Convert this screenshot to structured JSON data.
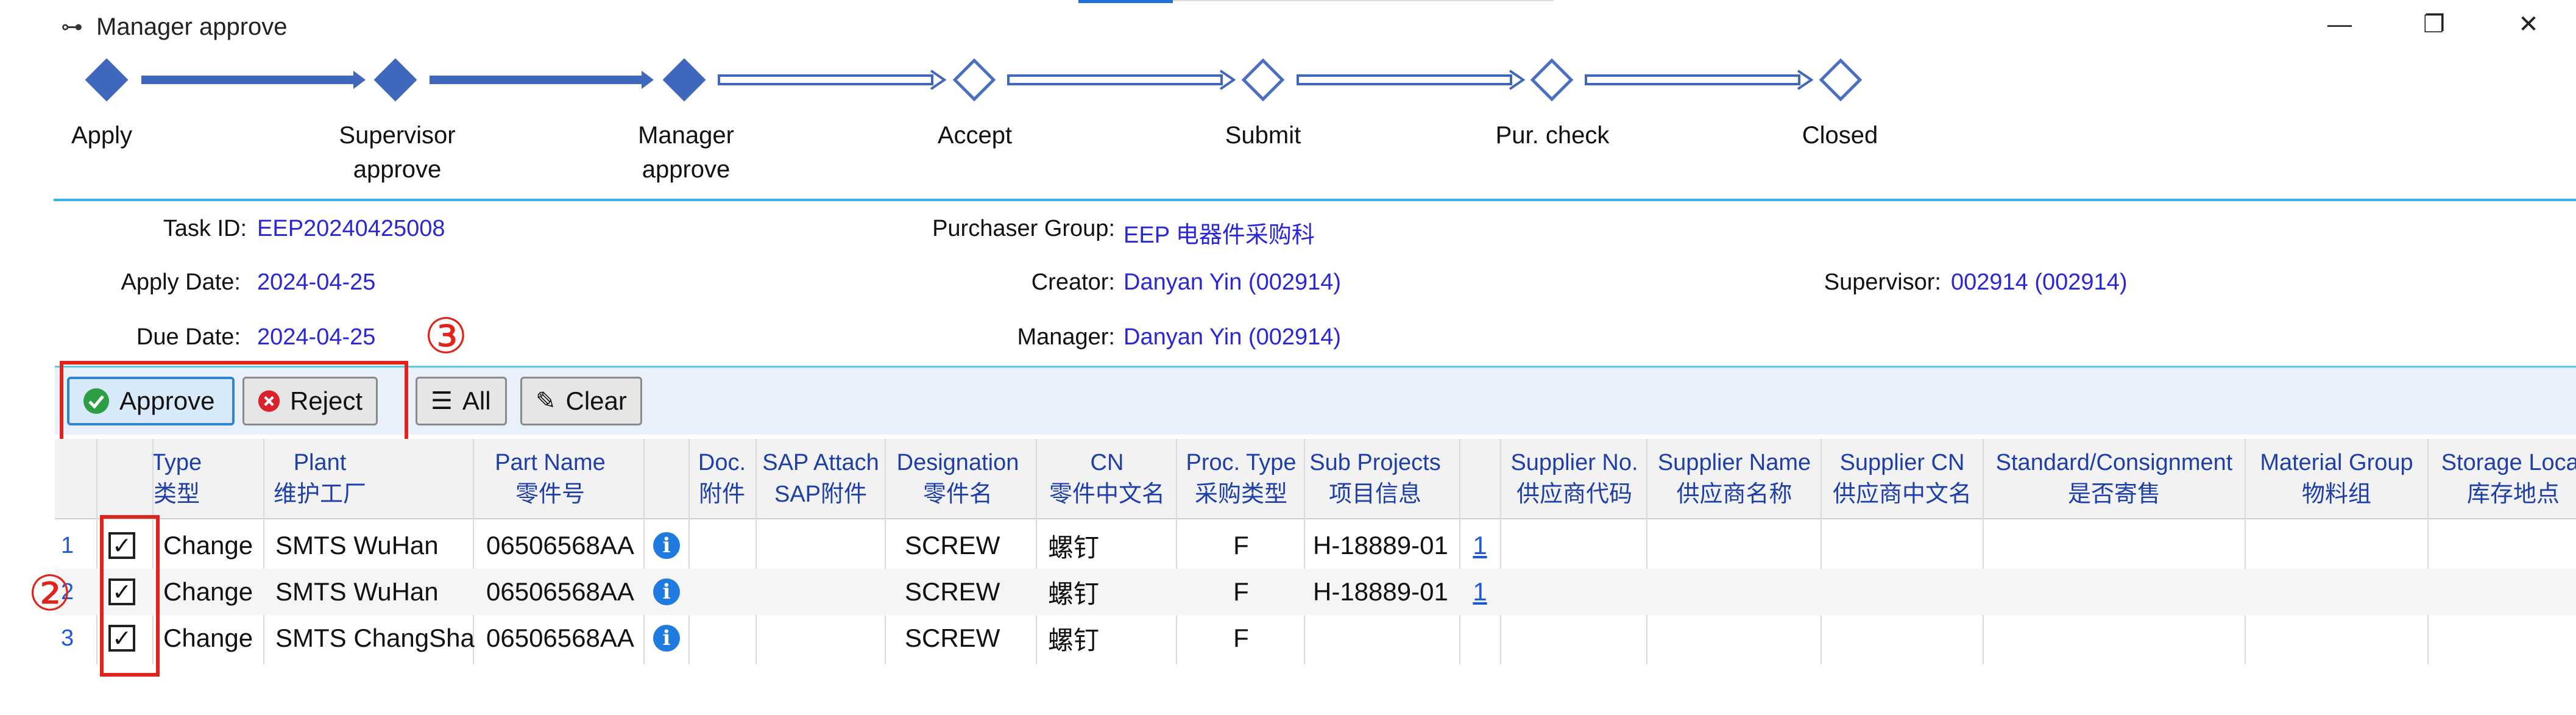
{
  "window": {
    "title": "Manager approve",
    "minimize": "—",
    "restore": "❐",
    "close": "✕"
  },
  "workflow": {
    "steps": [
      {
        "label": "Apply",
        "state": "done"
      },
      {
        "label": "Supervisor\napprove",
        "state": "done"
      },
      {
        "label": "Manager\napprove",
        "state": "done"
      },
      {
        "label": "Accept",
        "state": "todo"
      },
      {
        "label": "Submit",
        "state": "todo"
      },
      {
        "label": "Pur. check",
        "state": "todo"
      },
      {
        "label": "Closed",
        "state": "todo"
      }
    ]
  },
  "info": {
    "task_id_label": "Task ID:",
    "task_id": "EEP20240425008",
    "apply_date_label": "Apply Date:",
    "apply_date": "2024-04-25",
    "due_date_label": "Due Date:",
    "due_date": "2024-04-25",
    "purchaser_group_label": "Purchaser Group:",
    "purchaser_group": "EEP 电器件采购科",
    "creator_label": "Creator:",
    "creator": "Danyan Yin (002914)",
    "manager_label": "Manager:",
    "manager": "Danyan Yin (002914)",
    "supervisor_label": "Supervisor:",
    "supervisor": "002914 (002914)"
  },
  "toolbar": {
    "approve": "Approve",
    "reject": "Reject",
    "all": "All",
    "clear": "Clear"
  },
  "annotations": {
    "circle2": "②",
    "circle3": "③"
  },
  "table": {
    "columns": [
      {
        "en": "Type",
        "cn": "类型"
      },
      {
        "en": "Plant",
        "cn": "维护工厂"
      },
      {
        "en": "Part Name",
        "cn": "零件号"
      },
      {
        "en": "Doc.",
        "cn": "附件"
      },
      {
        "en": "SAP Attach",
        "cn": "SAP附件"
      },
      {
        "en": "Designation",
        "cn": "零件名"
      },
      {
        "en": "CN",
        "cn": "零件中文名"
      },
      {
        "en": "Proc. Type",
        "cn": "采购类型"
      },
      {
        "en": "Sub Projects",
        "cn": "项目信息"
      },
      {
        "en": "Supplier No.",
        "cn": "供应商代码"
      },
      {
        "en": "Supplier Name",
        "cn": "供应商名称"
      },
      {
        "en": "Supplier CN",
        "cn": "供应商中文名"
      },
      {
        "en": "Standard/Consignment",
        "cn": "是否寄售"
      },
      {
        "en": "Material Group",
        "cn": "物料组"
      },
      {
        "en": "Storage Locat",
        "cn": "库存地点"
      }
    ],
    "rows": [
      {
        "num": "1",
        "checked": "✓",
        "type": "Change",
        "plant": "SMTS WuHan",
        "part": "06506568AA",
        "designation": "SCREW",
        "cn": "螺钉",
        "proc": "F",
        "sub": "H-18889-01",
        "count": "1"
      },
      {
        "num": "2",
        "checked": "✓",
        "type": "Change",
        "plant": "SMTS WuHan",
        "part": "06506568AA",
        "designation": "SCREW",
        "cn": "螺钉",
        "proc": "F",
        "sub": "H-18889-01",
        "count": "1"
      },
      {
        "num": "3",
        "checked": "✓",
        "type": "Change",
        "plant": "SMTS ChangSha",
        "part": "06506568AA",
        "designation": "SCREW",
        "cn": "螺钉",
        "proc": "F",
        "sub": "",
        "count": ""
      }
    ]
  }
}
